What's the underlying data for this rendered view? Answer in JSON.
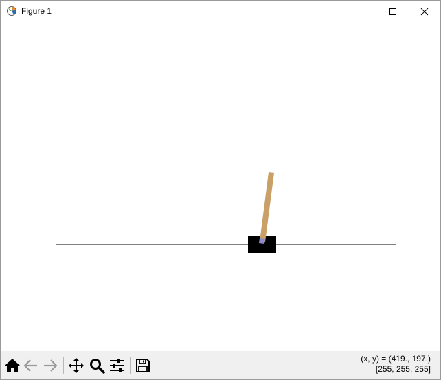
{
  "window": {
    "title": "Figure 1"
  },
  "toolbar": {
    "buttons": [
      "home-icon",
      "back-arrow-icon",
      "forward-arrow-icon",
      "pan-icon",
      "zoom-icon",
      "configure-subplots-icon",
      "save-icon"
    ]
  },
  "status": {
    "coords": "(x, y) = (419., 197.)",
    "pixel": "[255, 255, 255]"
  },
  "colors": {
    "pole": "#c9a067",
    "axle": "#8b8ad1",
    "cart": "#000000",
    "track": "#000000",
    "toolbar_bg": "#f0f0f0"
  }
}
